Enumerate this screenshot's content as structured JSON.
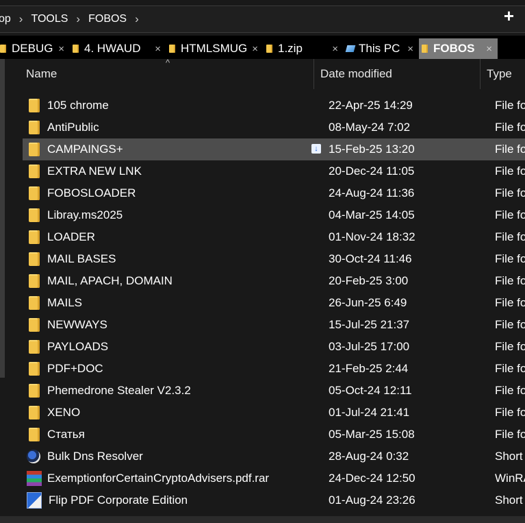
{
  "breadcrumb": {
    "parts": [
      "op",
      "TOOLS",
      "FOBOS"
    ]
  },
  "tabs": [
    {
      "label": "DEBUG",
      "icon": "folder-icon",
      "active": false
    },
    {
      "label": "4. HWAUD",
      "icon": "folder-icon",
      "active": false
    },
    {
      "label": "HTMLSMUG",
      "icon": "folder-icon",
      "active": false
    },
    {
      "label": "1.zip",
      "icon": "folder-icon",
      "active": false
    },
    {
      "label": "This PC",
      "icon": "pc-icon",
      "active": false
    },
    {
      "label": "FOBOS",
      "icon": "folder-icon",
      "active": true
    }
  ],
  "tab_close_glyph": "×",
  "new_tab_glyph": "+",
  "columns": {
    "name": "Name",
    "date": "Date modified",
    "type": "Type"
  },
  "rows": [
    {
      "name": "105 chrome",
      "date": "22-Apr-25 14:29",
      "type": "File fo",
      "icon": "folder"
    },
    {
      "name": "AntiPublic",
      "date": "08-May-24 7:02",
      "type": "File fo",
      "icon": "folder"
    },
    {
      "name": "CAMPAINGS+",
      "date": "15-Feb-25 13:20",
      "type": "File fo",
      "icon": "folder",
      "selected": true
    },
    {
      "name": "EXTRA NEW LNK",
      "date": "20-Dec-24 11:05",
      "type": "File fo",
      "icon": "folder"
    },
    {
      "name": "FOBOSLOADER",
      "date": "24-Aug-24 11:36",
      "type": "File fo",
      "icon": "folder"
    },
    {
      "name": "Libray.ms2025",
      "date": "04-Mar-25 14:05",
      "type": "File fo",
      "icon": "folder"
    },
    {
      "name": "LOADER",
      "date": "01-Nov-24 18:32",
      "type": "File fo",
      "icon": "folder"
    },
    {
      "name": "MAIL BASES",
      "date": "30-Oct-24 11:46",
      "type": "File fo",
      "icon": "folder"
    },
    {
      "name": "MAIL, APACH, DOMAIN",
      "date": "20-Feb-25 3:00",
      "type": "File fo",
      "icon": "folder"
    },
    {
      "name": "MAILS",
      "date": "26-Jun-25 6:49",
      "type": "File fo",
      "icon": "folder"
    },
    {
      "name": "NEWWAYS",
      "date": "15-Jul-25 21:37",
      "type": "File fo",
      "icon": "folder"
    },
    {
      "name": "PAYLOADS",
      "date": "03-Jul-25 17:00",
      "type": "File fo",
      "icon": "folder"
    },
    {
      "name": "PDF+DOC",
      "date": "21-Feb-25 2:44",
      "type": "File fo",
      "icon": "folder"
    },
    {
      "name": "Phemedrone Stealer V2.3.2",
      "date": "05-Oct-24 12:11",
      "type": "File fo",
      "icon": "folder"
    },
    {
      "name": "XENO",
      "date": "01-Jul-24 21:41",
      "type": "File fo",
      "icon": "folder"
    },
    {
      "name": "Статья",
      "date": "05-Mar-25 15:08",
      "type": "File fo",
      "icon": "folder"
    },
    {
      "name": "Bulk Dns Resolver",
      "date": "28-Aug-24 0:32",
      "type": "Short",
      "icon": "app"
    },
    {
      "name": "ExemptionforCertainCryptoAdvisers.pdf.rar",
      "date": "24-Dec-24 12:50",
      "type": "WinRA",
      "icon": "rar"
    },
    {
      "name": "Flip PDF Corporate Edition",
      "date": "01-Aug-24 23:26",
      "type": "Short",
      "icon": "pdf"
    }
  ],
  "sync_badge_glyph": "↓",
  "colors": {
    "background": "#191919",
    "tabstrip": "#000000",
    "active_tab": "#7a7a7a",
    "selected_row": "#4d4d4d",
    "folder": "#f2c34a"
  }
}
